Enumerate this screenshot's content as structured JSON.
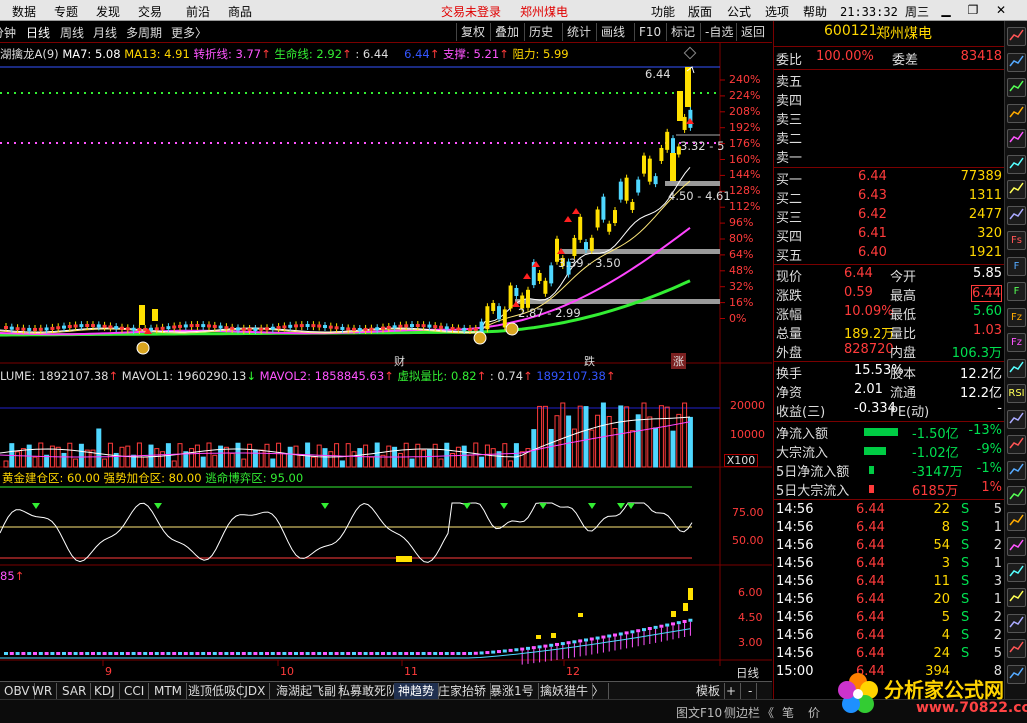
{
  "menu": {
    "items": [
      "数据",
      "专题",
      "发现",
      "交易",
      "前沿",
      "商品"
    ],
    "center": [
      "交易未登录",
      "郑州煤电"
    ],
    "right": [
      "功能",
      "版面",
      "公式",
      "选项",
      "帮助"
    ],
    "clock": "21:33:32",
    "weekday": "周三"
  },
  "toolbar": {
    "left": [
      "分钟",
      "日线",
      "周线",
      "月线",
      "多周期",
      "更多〉"
    ],
    "right": [
      "复权",
      "叠加",
      "历史",
      "统计",
      "画线",
      "F10",
      "标记",
      "-自选",
      "返回"
    ]
  },
  "main_legend": {
    "name": "湖擒龙A(9)",
    "ma7": "MA7: 5.08",
    "ma13": "MA13: 4.91",
    "zhuan": "转折线: 3.77",
    "life": "生命线: 2.92",
    "val": ": 6.44",
    "val2": "6.44",
    "support": "支撑: 5.21",
    "resist": "阻力: 5.99"
  },
  "annotations": {
    "peak": "6.44",
    "z1": "3.32 - 5",
    "z2": "4.50 - 4.61",
    "z3": "3.39 - 3.50",
    "z4": "2.87 - 2.99",
    "tag_cai": "财",
    "tag_die": "跌",
    "tag_zhang": "涨"
  },
  "chart_data": [
    {
      "type": "line",
      "title": "",
      "ylabel": "",
      "y_ticks": [
        "240%",
        "224%",
        "208%",
        "192%",
        "176%",
        "160%",
        "144%",
        "128%",
        "112%",
        "96%",
        "80%",
        "64%",
        "48%",
        "32%",
        "16%",
        "0%"
      ],
      "x_ticks": [
        "9",
        "10",
        "11",
        "12"
      ],
      "series": [
        {
          "name": "MA7",
          "last": 5.08
        },
        {
          "name": "MA13",
          "last": 4.91
        },
        {
          "name": "转折线",
          "last": 3.77
        },
        {
          "name": "生命线",
          "last": 2.92
        }
      ]
    },
    {
      "type": "bar",
      "legend": {
        "vol": "LUME: 1892107.38",
        "mavol1": "MAVOL1: 1960290.13",
        "mavol2": "MAVOL2: 1858845.63",
        "xuni": "虚拟量比: 0.82",
        "v2": ": 0.74",
        "v3": "1892107.38"
      },
      "y_ticks": [
        "20000",
        "10000"
      ],
      "unit": "X100"
    },
    {
      "type": "line",
      "legend": {
        "a": "黄金建仓区: 60.00",
        "b": "强势加仓区: 80.00",
        "c": "逃命博弈区: 95.00"
      },
      "y_ticks": [
        "75.00",
        "50.00"
      ]
    },
    {
      "type": "bar",
      "legend": "85",
      "y_ticks": [
        "6.00",
        "4.50",
        "3.00"
      ]
    }
  ],
  "panel": {
    "code": "600121",
    "name": "郑州煤电",
    "weibi_label": "委比",
    "weibi": "100.00%",
    "weicha_label": "委差",
    "weicha": "83418",
    "sell": [
      "卖五",
      "卖四",
      "卖三",
      "卖二",
      "卖一"
    ],
    "buy": [
      {
        "label": "买一",
        "price": "6.44",
        "vol": "77389"
      },
      {
        "label": "买二",
        "price": "6.43",
        "vol": "1311"
      },
      {
        "label": "买三",
        "price": "6.42",
        "vol": "2477"
      },
      {
        "label": "买四",
        "price": "6.41",
        "vol": "320"
      },
      {
        "label": "买五",
        "price": "6.40",
        "vol": "1921"
      }
    ],
    "quote": [
      {
        "l1": "现价",
        "v1": "6.44",
        "l2": "今开",
        "v2": "5.85"
      },
      {
        "l1": "涨跌",
        "v1": "0.59",
        "l2": "最高",
        "v2": "6.44"
      },
      {
        "l1": "涨幅",
        "v1": "10.09%",
        "l2": "最低",
        "v2": "5.60"
      },
      {
        "l1": "总量",
        "v1": "189.2万",
        "l2": "量比",
        "v2": "1.03"
      },
      {
        "l1": "外盘",
        "v1": "828720",
        "l2": "内盘",
        "v2": "106.3万"
      }
    ],
    "fund": [
      {
        "l1": "换手",
        "v1": "15.53%",
        "l2": "股本",
        "v2": "12.2亿"
      },
      {
        "l1": "净资",
        "v1": "2.01",
        "l2": "流通",
        "v2": "12.2亿"
      },
      {
        "l1": "收益(三)",
        "v1": "-0.334",
        "l2": "PE(动)",
        "v2": "-"
      }
    ],
    "flow": [
      {
        "l": "净流入额",
        "v": "-1.50亿",
        "p": "-13%"
      },
      {
        "l": "大宗流入",
        "v": "-1.02亿",
        "p": "-9%"
      },
      {
        "l": "5日净流入额",
        "v": "-3147万",
        "p": "-1%"
      },
      {
        "l": "5日大宗流入",
        "v": "6185万",
        "p": "1%"
      }
    ],
    "ticks": [
      {
        "t": "14:56",
        "p": "6.44",
        "v": "22",
        "s": "S",
        "n": "5"
      },
      {
        "t": "14:56",
        "p": "6.44",
        "v": "8",
        "s": "S",
        "n": "1"
      },
      {
        "t": "14:56",
        "p": "6.44",
        "v": "54",
        "s": "S",
        "n": "2"
      },
      {
        "t": "14:56",
        "p": "6.44",
        "v": "3",
        "s": "S",
        "n": "1"
      },
      {
        "t": "14:56",
        "p": "6.44",
        "v": "11",
        "s": "S",
        "n": "3"
      },
      {
        "t": "14:56",
        "p": "6.44",
        "v": "20",
        "s": "S",
        "n": "1"
      },
      {
        "t": "14:56",
        "p": "6.44",
        "v": "5",
        "s": "S",
        "n": "2"
      },
      {
        "t": "14:56",
        "p": "6.44",
        "v": "4",
        "s": "S",
        "n": "2"
      },
      {
        "t": "14:56",
        "p": "6.44",
        "v": "24",
        "s": "S",
        "n": "5"
      },
      {
        "t": "15:00",
        "p": "6.44",
        "v": "394",
        "s": "",
        "n": "8"
      }
    ]
  },
  "tabs": [
    "OBV",
    "WR",
    "SAR",
    "KDJ",
    "CCI",
    "MTM",
    "逃顶低吸",
    "CJDX",
    "海湖起飞副",
    "私募敢死队",
    "神趋势",
    "庄家抬轿",
    "暴涨1号",
    "擒妖猎牛",
    "〉",
    "模板",
    "+",
    "-"
  ],
  "period_label": "日线",
  "status": [
    "图文F10",
    "侧边栏",
    "《",
    "笔",
    "价"
  ],
  "logo": {
    "text": "分析家公式网",
    "url_text": "www.70822.com"
  },
  "side_icons": [
    "icon-1",
    "icon-2",
    "icon-3",
    "icon-4",
    "icon-5",
    "icon-6",
    "icon-7",
    "icon-8",
    "Fs",
    "F",
    "F",
    "Fz",
    "Fz",
    "icon-14",
    "RSI",
    "icon-16",
    "icon-17",
    "icon-18",
    "icon-19",
    "icon-20",
    "icon-21",
    "icon-22",
    "icon-23",
    "icon-24",
    "icon-25",
    "icon-26"
  ]
}
